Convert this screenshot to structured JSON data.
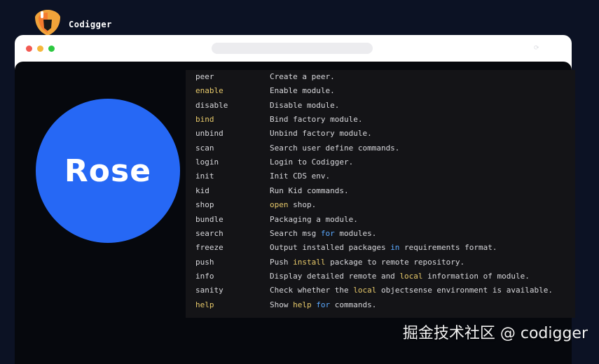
{
  "brand": {
    "name": "Codigger",
    "logo_icon": "shield-logo-icon"
  },
  "window": {
    "controls": [
      "close",
      "minimize",
      "maximize"
    ],
    "logo_text": "Rose"
  },
  "commands": [
    {
      "cmd": "peer",
      "hl": false,
      "desc": [
        {
          "t": "Create a peer."
        }
      ]
    },
    {
      "cmd": "enable",
      "hl": true,
      "desc": [
        {
          "t": "Enable module."
        }
      ]
    },
    {
      "cmd": "disable",
      "hl": false,
      "desc": [
        {
          "t": "Disable module."
        }
      ]
    },
    {
      "cmd": "bind",
      "hl": true,
      "desc": [
        {
          "t": "Bind factory module."
        }
      ]
    },
    {
      "cmd": "unbind",
      "hl": false,
      "desc": [
        {
          "t": "Unbind factory module."
        }
      ]
    },
    {
      "cmd": "scan",
      "hl": false,
      "desc": [
        {
          "t": "Search user define commands."
        }
      ]
    },
    {
      "cmd": "login",
      "hl": false,
      "desc": [
        {
          "t": "Login to Codigger."
        }
      ]
    },
    {
      "cmd": "init",
      "hl": false,
      "desc": [
        {
          "t": "Init CDS env."
        }
      ]
    },
    {
      "cmd": "kid",
      "hl": false,
      "desc": [
        {
          "t": "Run Kid commands."
        }
      ]
    },
    {
      "cmd": "shop",
      "hl": false,
      "desc": [
        {
          "t": "open",
          "c": "y"
        },
        {
          "t": " shop."
        }
      ]
    },
    {
      "cmd": "bundle",
      "hl": false,
      "desc": [
        {
          "t": "Packaging a module."
        }
      ]
    },
    {
      "cmd": "search",
      "hl": false,
      "desc": [
        {
          "t": "Search msg "
        },
        {
          "t": "for",
          "c": "b"
        },
        {
          "t": " modules."
        }
      ]
    },
    {
      "cmd": "freeze",
      "hl": false,
      "desc": [
        {
          "t": "Output installed packages "
        },
        {
          "t": "in",
          "c": "b"
        },
        {
          "t": " requirements format."
        }
      ]
    },
    {
      "cmd": "push",
      "hl": false,
      "desc": [
        {
          "t": "Push "
        },
        {
          "t": "install",
          "c": "y"
        },
        {
          "t": " package to remote repository."
        }
      ]
    },
    {
      "cmd": "info",
      "hl": false,
      "desc": [
        {
          "t": "Display detailed remote and "
        },
        {
          "t": "local",
          "c": "y"
        },
        {
          "t": " information of module."
        }
      ]
    },
    {
      "cmd": "sanity",
      "hl": false,
      "desc": [
        {
          "t": "Check whether the "
        },
        {
          "t": "local",
          "c": "y"
        },
        {
          "t": " objectsense environment is available."
        }
      ]
    },
    {
      "cmd": "help",
      "hl": true,
      "desc": [
        {
          "t": "Show "
        },
        {
          "t": "help",
          "c": "y"
        },
        {
          "t": " "
        },
        {
          "t": "for",
          "c": "b"
        },
        {
          "t": " commands."
        }
      ]
    }
  ],
  "watermark": "掘金技术社区 @ codigger",
  "colors": {
    "accent_blue": "#2668f5",
    "keyword_yellow": "#e7c96a",
    "keyword_blue": "#5aa9ff"
  }
}
